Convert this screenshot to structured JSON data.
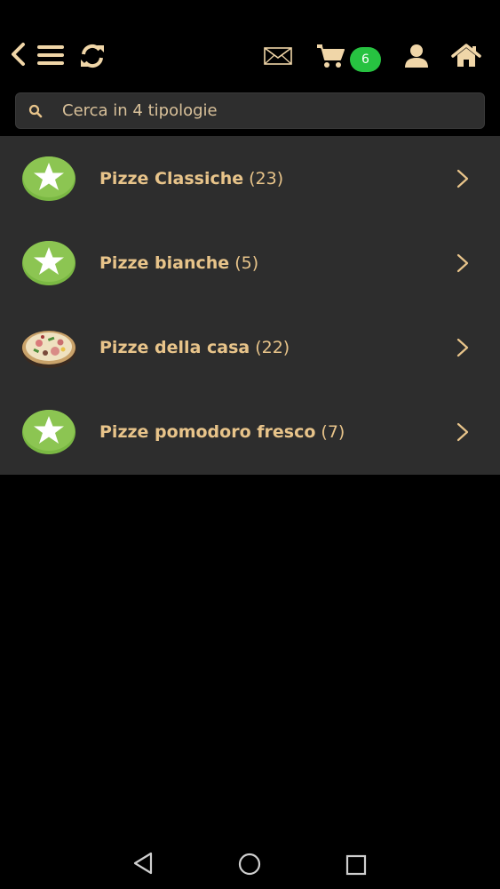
{
  "topbar": {
    "icons": [
      "back-icon",
      "menu-icon",
      "refresh-icon",
      "mail-icon",
      "cart-icon",
      "user-icon",
      "home-icon"
    ],
    "cart_count": "6",
    "icon_color": "#f0d6a8",
    "badge_color": "#27c241"
  },
  "search": {
    "placeholder": "Cerca in 4 tipologie"
  },
  "categories": [
    {
      "name": "Pizze Classiche",
      "count": "(23)",
      "thumb": "green-star"
    },
    {
      "name": "Pizze bianche",
      "count": "(5)",
      "thumb": "green-star"
    },
    {
      "name": "Pizze della casa",
      "count": "(22)",
      "thumb": "pizza-photo"
    },
    {
      "name": "Pizze pomodoro fresco",
      "count": "(7)",
      "thumb": "green-star"
    }
  ],
  "colors": {
    "text_gold": "#e8c48a",
    "list_bg": "#2d2d2d",
    "page_bg": "#000000",
    "star_green": "#7ab843"
  },
  "navbar": {
    "icons": [
      "nav-back-icon",
      "nav-home-icon",
      "nav-recents-icon"
    ]
  }
}
